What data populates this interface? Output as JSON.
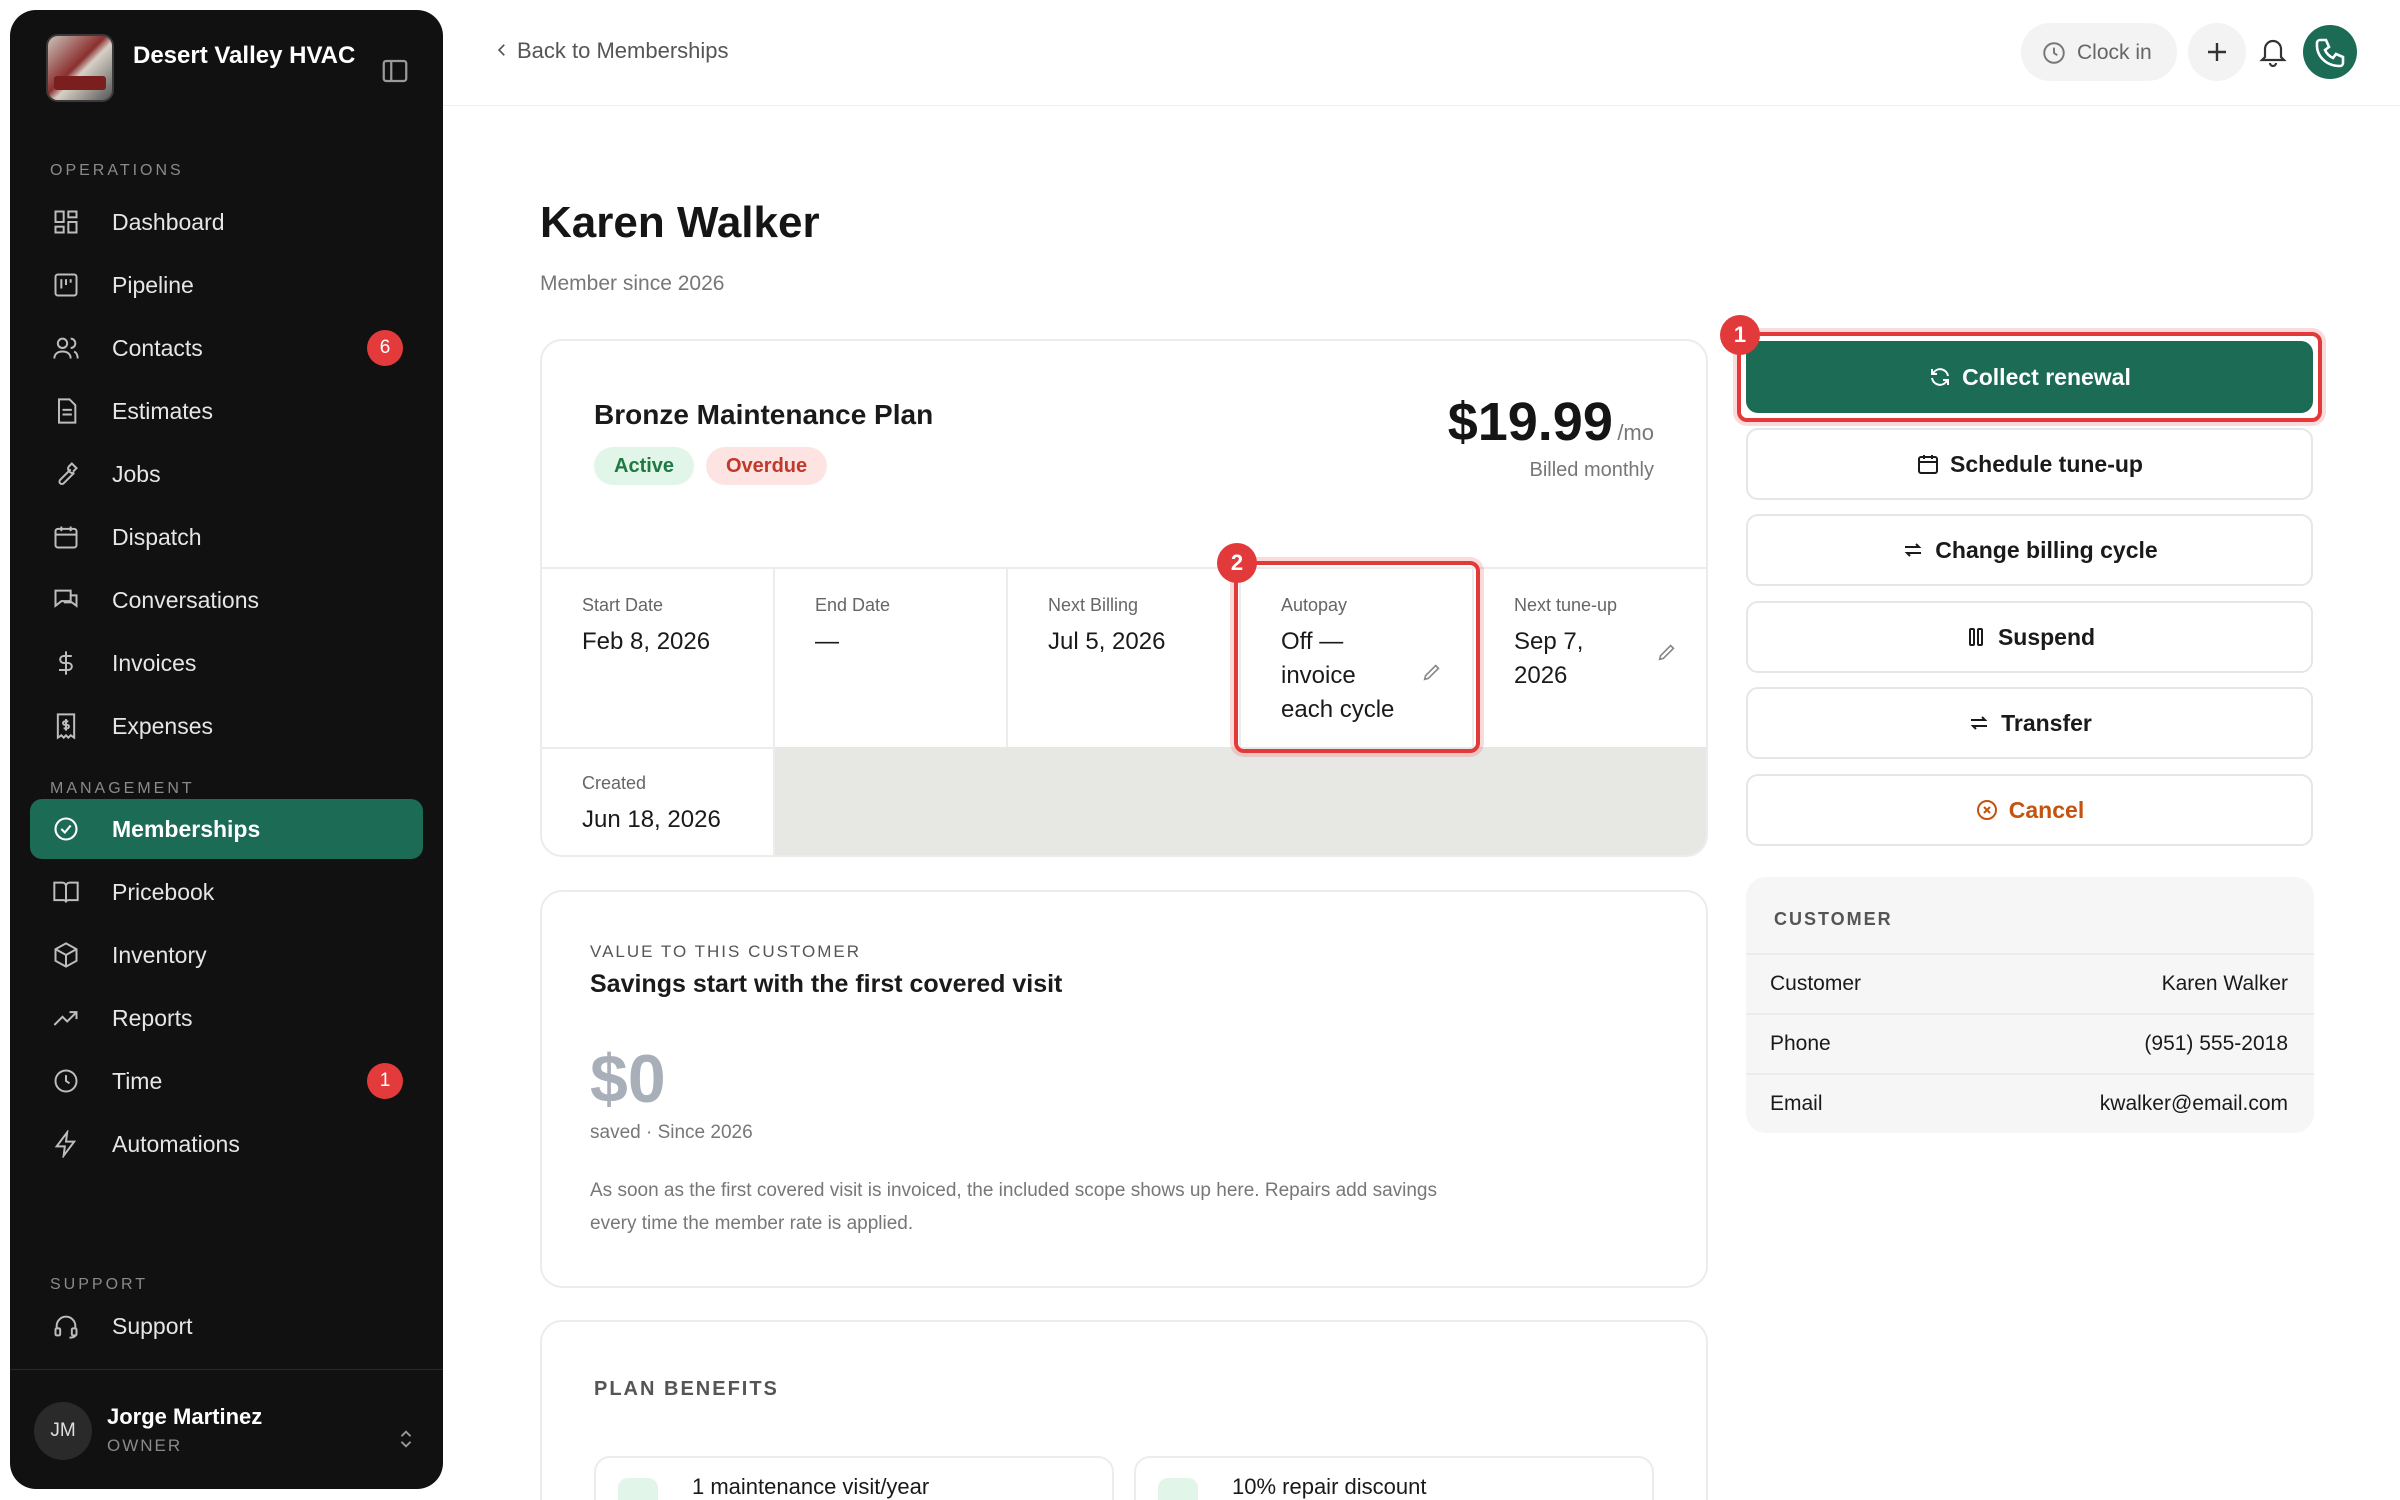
{
  "brand": {
    "name": "Desert Valley HVAC"
  },
  "sidebar": {
    "section_operations": "OPERATIONS",
    "section_management": "MANAGEMENT",
    "section_support": "SUPPORT",
    "items": [
      {
        "label": "Dashboard"
      },
      {
        "label": "Pipeline"
      },
      {
        "label": "Contacts",
        "badge": "6"
      },
      {
        "label": "Estimates"
      },
      {
        "label": "Jobs"
      },
      {
        "label": "Dispatch"
      },
      {
        "label": "Conversations"
      },
      {
        "label": "Invoices"
      },
      {
        "label": "Expenses"
      },
      {
        "label": "Memberships"
      },
      {
        "label": "Pricebook"
      },
      {
        "label": "Inventory"
      },
      {
        "label": "Reports"
      },
      {
        "label": "Time",
        "badge": "1"
      },
      {
        "label": "Automations"
      },
      {
        "label": "Support"
      }
    ],
    "user": {
      "initials": "JM",
      "name": "Jorge Martinez",
      "role": "OWNER"
    }
  },
  "topbar": {
    "back_label": "Back to Memberships",
    "clock_label": "Clock in"
  },
  "member": {
    "name": "Karen Walker",
    "since": "Member since 2026"
  },
  "plan": {
    "name": "Bronze Maintenance Plan",
    "status_active": "Active",
    "status_overdue": "Overdue",
    "price": "$19.99",
    "price_unit": "/mo",
    "billing_note": "Billed monthly",
    "details": {
      "start_label": "Start Date",
      "start_value": "Feb 8, 2026",
      "end_label": "End Date",
      "end_value": "—",
      "next_billing_label": "Next Billing",
      "next_billing_value": "Jul 5, 2026",
      "autopay_label": "Autopay",
      "autopay_value": "Off — invoice each cycle",
      "tuneup_label": "Next tune-up",
      "tuneup_value": "Sep 7, 2026",
      "created_label": "Created",
      "created_value": "Jun 18, 2026"
    }
  },
  "value_card": {
    "eyebrow": "VALUE TO THIS CUSTOMER",
    "heading": "Savings start with the first covered visit",
    "amount": "$0",
    "sub": "saved · Since 2026",
    "description": "As soon as the first covered visit is invoiced, the included scope shows up here. Repairs add savings every time the member rate is applied."
  },
  "benefits": {
    "title": "PLAN BENEFITS",
    "items": [
      "1 maintenance visit/year",
      "10% repair discount"
    ]
  },
  "actions": {
    "collect": "Collect renewal",
    "schedule": "Schedule tune-up",
    "change_cycle": "Change billing cycle",
    "suspend": "Suspend",
    "transfer": "Transfer",
    "cancel": "Cancel"
  },
  "customer": {
    "title": "CUSTOMER",
    "rows": [
      {
        "label": "Customer",
        "value": "Karen Walker"
      },
      {
        "label": "Phone",
        "value": "(951) 555-2018"
      },
      {
        "label": "Email",
        "value": "kwalker@email.com"
      }
    ]
  },
  "annotations": {
    "marker_1": "1",
    "marker_2": "2"
  },
  "colors": {
    "accent": "#1c6b55",
    "highlight": "#e23a3a",
    "danger": "#c5520f",
    "sidebar": "#111111"
  }
}
